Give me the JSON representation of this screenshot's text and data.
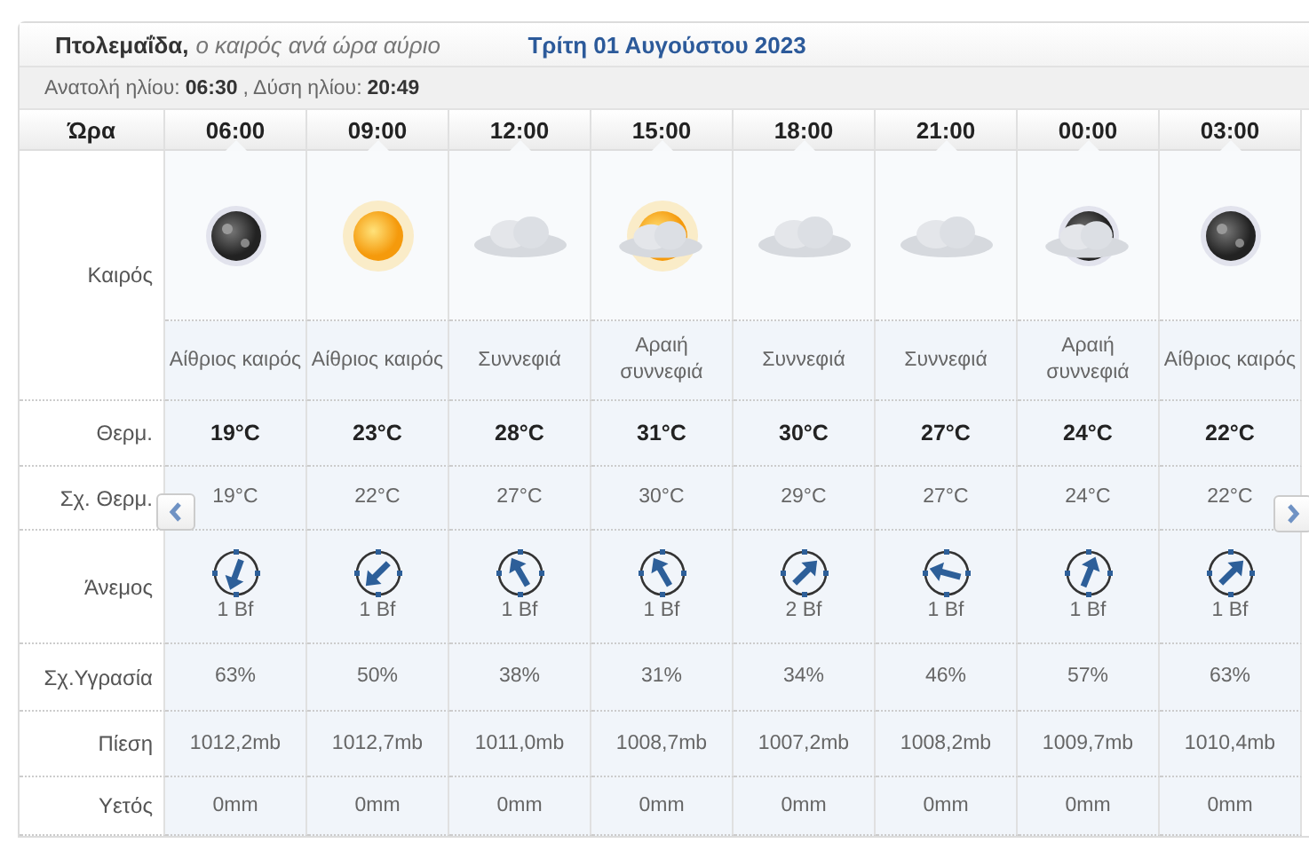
{
  "header": {
    "city": "Πτολεμαΐδα,",
    "subtitle": "ο καιρός ανά ώρα αύριο",
    "date": "Τρίτη 01 Αυγούστου 2023"
  },
  "sun": {
    "sunrise_label": "Ανατολή ηλίου:",
    "sunrise": "06:30",
    "sunset_label": ", Δύση ηλίου:",
    "sunset": "20:49"
  },
  "row_labels": {
    "hour": "Ώρα",
    "weather": "Καιρός",
    "temp": "Θερμ.",
    "feel": "Σχ. Θερμ.",
    "wind": "Άνεμος",
    "humidity": "Σχ.Υγρασία",
    "pressure": "Πίεση",
    "rain": "Υετός"
  },
  "hours": [
    {
      "time": "06:00",
      "kind": "moon",
      "desc": "Αίθριος καιρός",
      "temp": "19°C",
      "feel": "19°C",
      "wind_arrow": {
        "kind": "ssw"
      },
      "wind": "1 Bf",
      "humidity": "63%",
      "pressure": "1012,2mb",
      "rain": "0mm"
    },
    {
      "time": "09:00",
      "kind": "sun",
      "desc": "Αίθριος καιρός",
      "temp": "23°C",
      "feel": "22°C",
      "wind_arrow": {
        "kind": "sw"
      },
      "wind": "1 Bf",
      "humidity": "50%",
      "pressure": "1012,7mb",
      "rain": "0mm"
    },
    {
      "time": "12:00",
      "kind": "clouds",
      "desc": "Συννεφιά",
      "temp": "28°C",
      "feel": "27°C",
      "wind_arrow": {
        "kind": "nnw"
      },
      "wind": "1 Bf",
      "humidity": "38%",
      "pressure": "1011,0mb",
      "rain": "0mm"
    },
    {
      "time": "15:00",
      "kind": "sun_cloud",
      "desc": "Αραιή συννεφιά",
      "temp": "31°C",
      "feel": "30°C",
      "wind_arrow": {
        "kind": "nnw"
      },
      "wind": "1 Bf",
      "humidity": "31%",
      "pressure": "1008,7mb",
      "rain": "0mm"
    },
    {
      "time": "18:00",
      "kind": "clouds",
      "desc": "Συννεφιά",
      "temp": "30°C",
      "feel": "29°C",
      "wind_arrow": {
        "kind": "ne"
      },
      "wind": "2 Bf",
      "humidity": "34%",
      "pressure": "1007,2mb",
      "rain": "0mm"
    },
    {
      "time": "21:00",
      "kind": "clouds",
      "desc": "Συννεφιά",
      "temp": "27°C",
      "feel": "27°C",
      "wind_arrow": {
        "kind": "wnw"
      },
      "wind": "1 Bf",
      "humidity": "46%",
      "pressure": "1008,2mb",
      "rain": "0mm"
    },
    {
      "time": "00:00",
      "kind": "moon_cloud",
      "desc": "Αραιή συννεφιά",
      "temp": "24°C",
      "feel": "24°C",
      "wind_arrow": {
        "kind": "nne"
      },
      "wind": "1 Bf",
      "humidity": "57%",
      "pressure": "1009,7mb",
      "rain": "0mm"
    },
    {
      "time": "03:00",
      "kind": "moon",
      "desc": "Αίθριος καιρός",
      "temp": "22°C",
      "feel": "22°C",
      "wind_arrow": {
        "kind": "ne"
      },
      "wind": "1 Bf",
      "humidity": "63%",
      "pressure": "1010,4mb",
      "rain": "0mm"
    }
  ]
}
